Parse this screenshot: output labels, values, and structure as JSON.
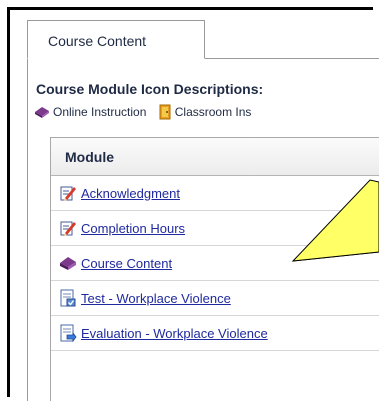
{
  "tabs": {
    "active_label": "Course Content"
  },
  "legend": {
    "title": "Course Module Icon Descriptions:",
    "items": [
      {
        "icon": "purple-book-icon",
        "label": "Online Instruction"
      },
      {
        "icon": "classroom-door-icon",
        "label": "Classroom Ins"
      }
    ]
  },
  "grid": {
    "header": "Module",
    "rows": [
      {
        "icon": "pencil-document-icon",
        "label": "Acknowledgment"
      },
      {
        "icon": "pencil-document-icon",
        "label": "Completion Hours"
      },
      {
        "icon": "purple-book-icon",
        "label": "Course Content"
      },
      {
        "icon": "test-document-icon",
        "label": "Test - Workplace Violence"
      },
      {
        "icon": "evaluation-document-icon",
        "label": "Evaluation - Workplace Violence"
      }
    ]
  },
  "colors": {
    "link": "#1f2a9e",
    "text": "#1f2a44",
    "callout_fill": "#ffff66",
    "book": "#6b2c7a"
  }
}
